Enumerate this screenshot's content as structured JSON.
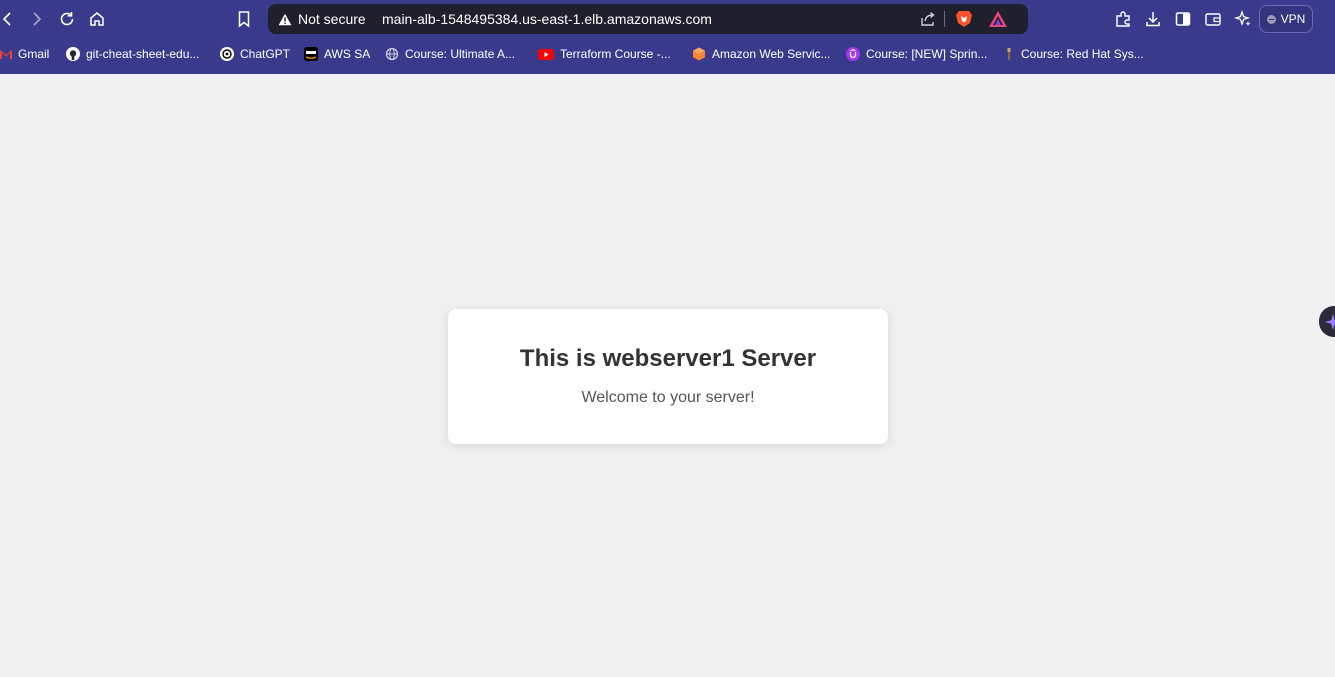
{
  "browser": {
    "security_label": "Not secure",
    "url": "main-alb-1548495384.us-east-1.elb.amazonaws.com",
    "vpn_label": "VPN"
  },
  "bookmarks": [
    {
      "label": "Gmail",
      "icon": "gmail-icon",
      "color": "#ea4335"
    },
    {
      "label": "git-cheat-sheet-edu...",
      "icon": "github-icon",
      "color": "#ffffff"
    },
    {
      "label": "ChatGPT",
      "icon": "chatgpt-icon",
      "color": "#ffffff"
    },
    {
      "label": "AWS SA",
      "icon": "aws-icon",
      "color": "#232f3e"
    },
    {
      "label": "Course: Ultimate A...",
      "icon": "globe-icon",
      "color": "#cfcfe0"
    },
    {
      "label": "Terraform Course -...",
      "icon": "youtube-icon",
      "color": "#ff0000"
    },
    {
      "label": "Amazon Web Servic...",
      "icon": "aws-box-icon",
      "color": "#f58534"
    },
    {
      "label": "Course: [NEW] Sprin...",
      "icon": "udemy-icon",
      "color": "#a435f0"
    },
    {
      "label": "Course: Red Hat Sys...",
      "icon": "redhat-icon",
      "color": "#c9a46a"
    }
  ],
  "page": {
    "heading": "This is webserver1 Server",
    "message": "Welcome to your server!"
  },
  "colors": {
    "chrome": "#3a3a8c",
    "page_background": "#f0f0f0",
    "card": "#ffffff"
  }
}
